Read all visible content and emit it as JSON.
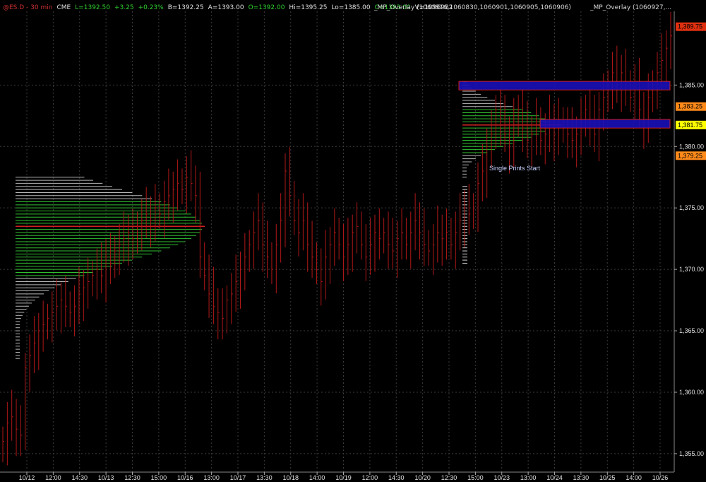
{
  "header": {
    "symbol": "@ES.D - 30 min",
    "exchange": "CME",
    "last": "L=1392.50",
    "change": "+3.25",
    "change_pct": "+0.23%",
    "bid": "B=1392.25",
    "ask": "A=1393.00",
    "open": "O=1392.00",
    "high": "Hi=1395.25",
    "low": "Lo=1385.00",
    "close": "C=1393.00",
    "volume": "V=1096982"
  },
  "overlays": {
    "overlay1": "_MP_Overlay  (1060816,1060830,1060901,1060905,1060906)",
    "overlay2": "_MP_Overlay  (1060927,..."
  },
  "colors": {
    "background": "#000000",
    "bar": "#b01818",
    "green": "#2fc02f",
    "poc": "#d02020",
    "zone_fill": "#1a10b8",
    "zone_border": "#d02020",
    "grid": "#3a3a3a"
  },
  "chart_data": {
    "type": "ohlc",
    "title": "@ES.D - 30 min",
    "ylim": [
      1353.5,
      1391
    ],
    "y_ticks": [
      "1,385.00",
      "1,380.00",
      "1,375.00",
      "1,370.00",
      "1,365.00",
      "1,360.00",
      "1,355.00"
    ],
    "y_tick_values": [
      1385,
      1380,
      1375,
      1370,
      1365,
      1360,
      1355
    ],
    "price_tags": [
      {
        "label": "1,389.75",
        "value": 1389.75,
        "color": "#e03010"
      },
      {
        "label": "1,383.25",
        "value": 1383.25,
        "color": "#ff8a1a"
      },
      {
        "label": "1,381.75",
        "value": 1381.75,
        "color": "#ffff00"
      },
      {
        "label": "1,379.25",
        "value": 1379.25,
        "color": "#ff8a1a"
      }
    ],
    "x_ticks": [
      "10/12",
      "12:00",
      "14:30",
      "10/13",
      "12:30",
      "15:00",
      "10/16",
      "13:00",
      "10/17",
      "13:30",
      "10/18",
      "14:00",
      "10/19",
      "12:00",
      "14:30",
      "10/20",
      "12:30",
      "15:00",
      "10/23",
      "13:00",
      "10/24",
      "13:30",
      "10/25",
      "14:00",
      "10/26"
    ],
    "annotation": "Single Prints Start",
    "zones": [
      {
        "low": 1384.6,
        "high": 1385.3
      },
      {
        "low": 1381.5,
        "high": 1382.2
      }
    ],
    "closes": [
      1356,
      1357.5,
      1358,
      1357,
      1356.5,
      1362,
      1363,
      1364,
      1365,
      1365.5,
      1366,
      1366.5,
      1367,
      1367.5,
      1367,
      1366.5,
      1367,
      1368,
      1368.5,
      1369,
      1369.5,
      1370,
      1369.5,
      1371,
      1370.5,
      1371.5,
      1372,
      1372.5,
      1373,
      1372.5,
      1373.5,
      1374,
      1374.5,
      1374,
      1375,
      1374.5,
      1375.5,
      1376,
      1376.5,
      1377,
      1376.5,
      1377.5,
      1377,
      1376,
      1371,
      1369.5,
      1368,
      1367,
      1366.5,
      1366,
      1367.5,
      1368,
      1369,
      1370,
      1371,
      1372,
      1373,
      1374,
      1372,
      1371,
      1370,
      1372,
      1374,
      1378,
      1376,
      1374,
      1373,
      1374,
      1372,
      1371,
      1370,
      1369,
      1371,
      1372,
      1373,
      1372,
      1371,
      1372,
      1373,
      1373.5,
      1372,
      1371,
      1372,
      1373,
      1372.5,
      1373,
      1372,
      1371.5,
      1372.5,
      1373,
      1372,
      1373,
      1374,
      1373,
      1372,
      1371.5,
      1372,
      1373,
      1372.5,
      1373,
      1372,
      1373,
      1374,
      1375,
      1374.5,
      1375,
      1377,
      1378,
      1380,
      1381,
      1383,
      1382,
      1381,
      1380,
      1382,
      1383,
      1381.5,
      1380.5,
      1381,
      1382,
      1380.5,
      1381,
      1382,
      1381,
      1382,
      1381.5,
      1381,
      1380.5,
      1381,
      1382,
      1383,
      1382,
      1381,
      1383,
      1384,
      1385,
      1386,
      1385,
      1386,
      1385,
      1384,
      1385,
      1383,
      1382,
      1384,
      1385,
      1386,
      1387,
      1388,
      1389
    ]
  }
}
